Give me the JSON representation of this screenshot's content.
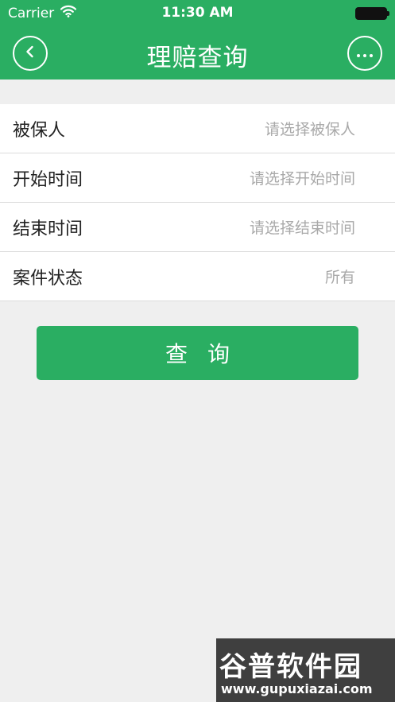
{
  "status_bar": {
    "carrier": "Carrier",
    "time": "11:30 AM",
    "wifi_icon": "wifi-icon",
    "battery_icon": "battery-icon"
  },
  "navbar": {
    "title": "理赔查询",
    "back_icon": "back-icon",
    "more_icon": "more-icon"
  },
  "form": {
    "rows": [
      {
        "label": "被保人",
        "value": "请选择被保人"
      },
      {
        "label": "开始时间",
        "value": "请选择开始时间"
      },
      {
        "label": "结束时间",
        "value": "请选择结束时间"
      },
      {
        "label": "案件状态",
        "value": "所有"
      }
    ]
  },
  "query_button": {
    "label": "查 询"
  },
  "watermark": {
    "title": "谷普软件园",
    "url": "www.gupuxiazai.com"
  },
  "colors": {
    "brand": "#2aae62",
    "background": "#efefef",
    "placeholder": "#a9a9a9"
  }
}
